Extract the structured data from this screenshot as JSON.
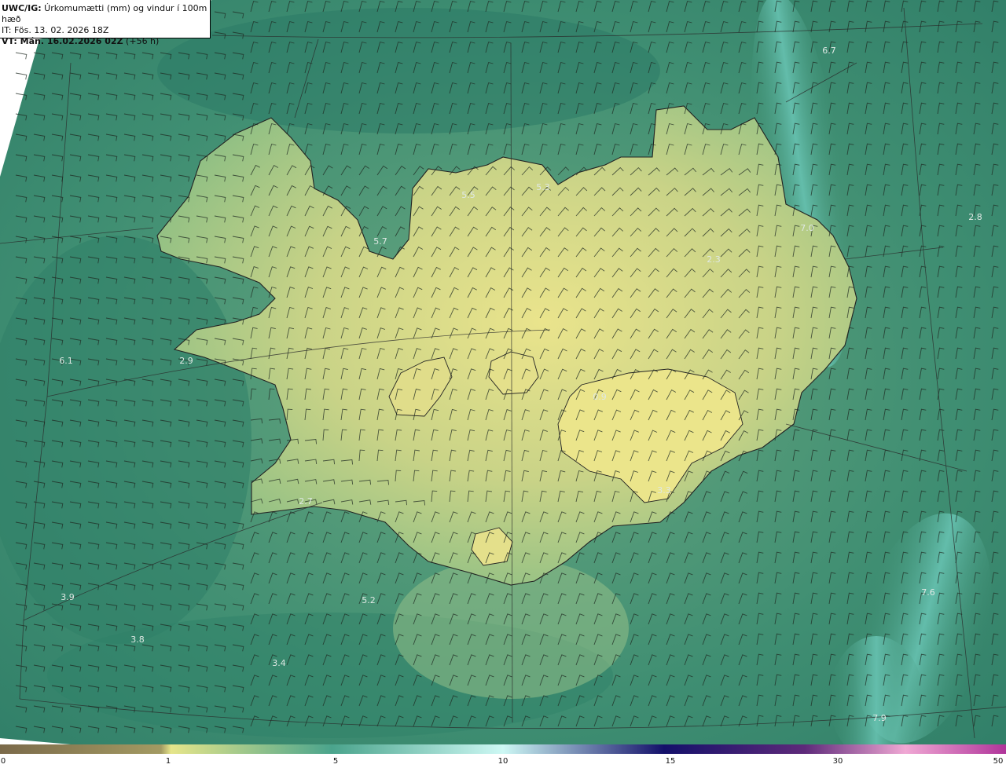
{
  "header": {
    "product": "UWC/IG:",
    "description": " Úrkomumætti (mm) og vindur í 100m hæð",
    "init_time": "IT: Fös. 13. 02. 2026 18Z",
    "valid_prefix": "VT: Mán. 16.02.2026 02Z",
    "valid_suffix": " (+56 h)"
  },
  "colorbar": {
    "ticks": [
      "0",
      "1",
      "5",
      "10",
      "15",
      "30",
      "50"
    ],
    "colors": [
      "#7b6a4a",
      "#a39a62",
      "#e6e58a",
      "#4aa48c",
      "#cdf8f4",
      "#14106a",
      "#5e2a7a",
      "#f0a8d4",
      "#b0349a"
    ]
  },
  "map_labels": [
    "6.7",
    "5.5",
    "5.3",
    "7.0",
    "2.8",
    "5.7",
    "2.3",
    "6.1",
    "2.9",
    "0.9",
    "2.7",
    "3.9",
    "5.2",
    "3.8",
    "3.4",
    "7.6",
    "7.9",
    "3.3"
  ],
  "map_colors": {
    "sea": "#3e8e72",
    "sea_dark": "#2b7a66",
    "land": "#cfd68c",
    "land_bright": "#e6e28e",
    "cyan_streak": "#5fbfae",
    "lines": "#2a2a2a"
  }
}
